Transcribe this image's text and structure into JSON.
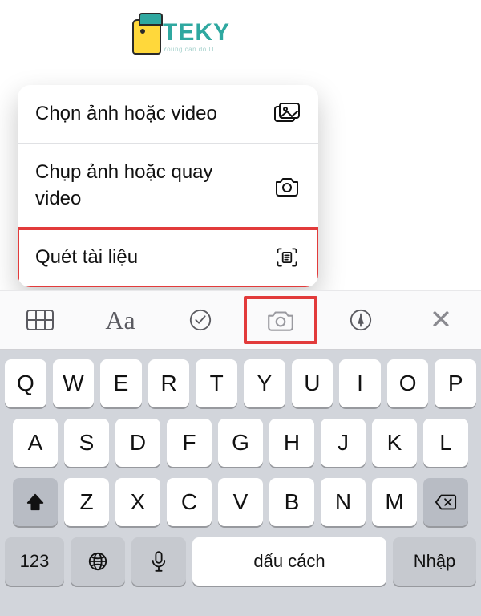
{
  "logo": {
    "brand": "TEKY",
    "tagline": "Young can do IT"
  },
  "menu": {
    "items": [
      {
        "label": "Chọn ảnh hoặc video",
        "icon": "gallery-icon"
      },
      {
        "label": "Chụp ảnh hoặc quay video",
        "icon": "camera-icon"
      },
      {
        "label": "Quét tài liệu",
        "icon": "scan-document-icon"
      }
    ]
  },
  "toolbar": {
    "text_format_label": "Aa",
    "close_label": "✕"
  },
  "keyboard": {
    "row1": [
      "Q",
      "W",
      "E",
      "R",
      "T",
      "Y",
      "U",
      "I",
      "O",
      "P"
    ],
    "row2": [
      "A",
      "S",
      "D",
      "F",
      "G",
      "H",
      "J",
      "K",
      "L"
    ],
    "row3": [
      "Z",
      "X",
      "C",
      "V",
      "B",
      "N",
      "M"
    ],
    "numbers_label": "123",
    "space_label": "dấu cách",
    "enter_label": "Nhập"
  },
  "highlight_color": "#e23b3b"
}
